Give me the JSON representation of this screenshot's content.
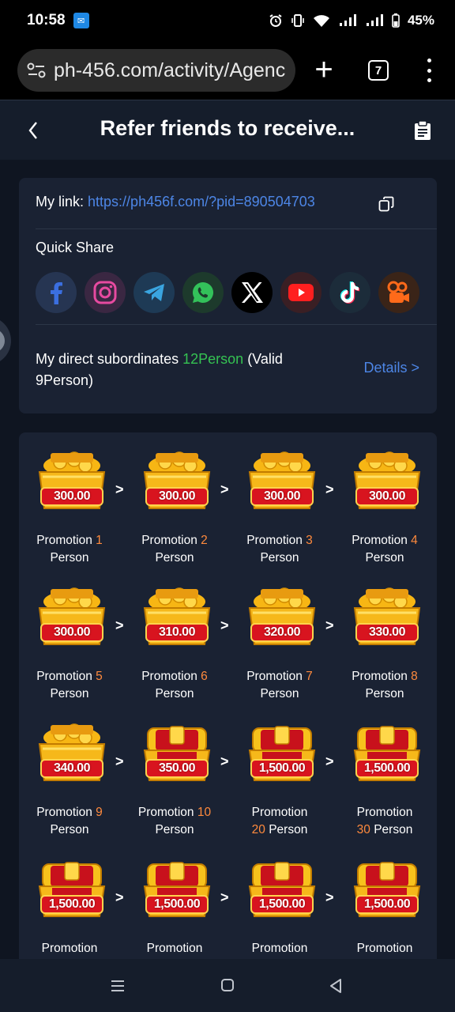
{
  "status": {
    "time": "10:58",
    "battery": "45%"
  },
  "browser": {
    "url": "ph-456.com/activity/Agenc",
    "tab_count": "7"
  },
  "header": {
    "title": "Refer friends to receive..."
  },
  "link": {
    "label": "My link:",
    "url": "https://ph456f.com/?pid=890504703"
  },
  "quick_share": {
    "label": "Quick Share",
    "icons": [
      "facebook-icon",
      "instagram-icon",
      "telegram-icon",
      "whatsapp-icon",
      "x-icon",
      "youtube-icon",
      "tiktok-icon",
      "kwai-icon"
    ]
  },
  "subordinates": {
    "prefix": "My direct subordinates",
    "count": "12Person",
    "valid": "(Valid 9Person)",
    "details": "Details >"
  },
  "rewards": [
    {
      "amount": "300.00",
      "word": "Promotion",
      "n": "1",
      "unit": "Person"
    },
    {
      "amount": "300.00",
      "word": "Promotion",
      "n": "2",
      "unit": "Person"
    },
    {
      "amount": "300.00",
      "word": "Promotion",
      "n": "3",
      "unit": "Person"
    },
    {
      "amount": "300.00",
      "word": "Promotion",
      "n": "4",
      "unit": "Person"
    },
    {
      "amount": "300.00",
      "word": "Promotion",
      "n": "5",
      "unit": "Person"
    },
    {
      "amount": "310.00",
      "word": "Promotion",
      "n": "6",
      "unit": "Person"
    },
    {
      "amount": "320.00",
      "word": "Promotion",
      "n": "7",
      "unit": "Person"
    },
    {
      "amount": "330.00",
      "word": "Promotion",
      "n": "8",
      "unit": "Person"
    },
    {
      "amount": "340.00",
      "word": "Promotion",
      "n": "9",
      "unit": "Person"
    },
    {
      "amount": "350.00",
      "word": "Promotion",
      "n": "10",
      "unit": "Person"
    },
    {
      "amount": "1,500.00",
      "word": "Promotion",
      "n": "20",
      "unit": "Person"
    },
    {
      "amount": "1,500.00",
      "word": "Promotion",
      "n": "30",
      "unit": "Person"
    },
    {
      "amount": "1,500.00",
      "word": "Promotion",
      "n": "",
      "unit": ""
    },
    {
      "amount": "1,500.00",
      "word": "Promotion",
      "n": "",
      "unit": ""
    },
    {
      "amount": "1,500.00",
      "word": "Promotion",
      "n": "",
      "unit": ""
    },
    {
      "amount": "1,500.00",
      "word": "Promotion",
      "n": "",
      "unit": ""
    }
  ],
  "arrow": ">",
  "colors": {
    "accent_blue": "#4d86e6",
    "green": "#35c252",
    "orange": "#ff8a3d"
  }
}
